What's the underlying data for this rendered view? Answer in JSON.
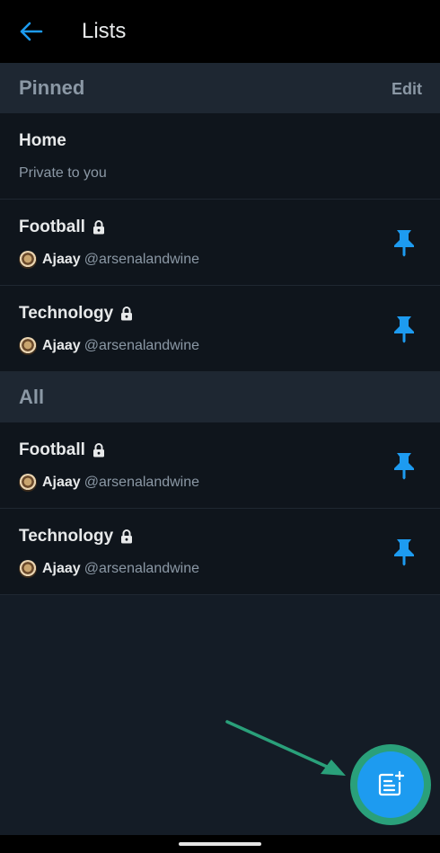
{
  "header": {
    "title": "Lists",
    "back_icon": "arrow-left-icon"
  },
  "colors": {
    "accent": "#1d9bf0",
    "annotation": "#2aa07a"
  },
  "pinned": {
    "title": "Pinned",
    "edit_label": "Edit",
    "items": [
      {
        "name": "Home",
        "subtitle": "Private to you"
      },
      {
        "name": "Football",
        "owner_name": "Ajaay",
        "owner_handle": "@arsenalandwine"
      },
      {
        "name": "Technology",
        "owner_name": "Ajaay",
        "owner_handle": "@arsenalandwine"
      }
    ]
  },
  "all": {
    "title": "All",
    "items": [
      {
        "name": "Football",
        "owner_name": "Ajaay",
        "owner_handle": "@arsenalandwine"
      },
      {
        "name": "Technology",
        "owner_name": "Ajaay",
        "owner_handle": "@arsenalandwine"
      }
    ]
  },
  "fab": {
    "icon": "new-list-icon"
  }
}
